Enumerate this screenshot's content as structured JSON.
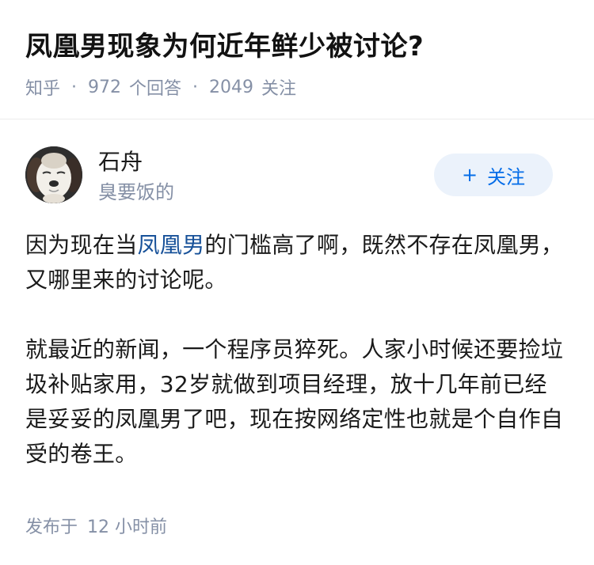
{
  "question": {
    "title": "凤凰男现象为何近年鲜少被讨论?",
    "source": "知乎",
    "separator": "·",
    "answer_count": "972",
    "answer_label": "个回答",
    "follow_count": "2049",
    "follow_label": "关注"
  },
  "author": {
    "name": "石舟",
    "bio": "臭要饭的",
    "follow_button_plus": "+",
    "follow_button_label": "关注"
  },
  "answer": {
    "para1_before": "因为现在当",
    "para1_link": "凤凰男",
    "para1_after": "的门槛高了啊，既然不存在凤凰男，又哪里来的讨论呢。",
    "para2": "就最近的新闻，一个程序员猝死。人家小时候还要捡垃圾补贴家用，32岁就做到项目经理，放十几年前已经是妥妥的凤凰男了吧，现在按网络定性也就是个自作自受的卷王。"
  },
  "footer": {
    "published_label": "发布于",
    "published_time": "12 小时前"
  },
  "colors": {
    "link": "#175199",
    "accent": "#056de8",
    "button_bg": "#ebf2fb",
    "muted": "#8590a6"
  }
}
